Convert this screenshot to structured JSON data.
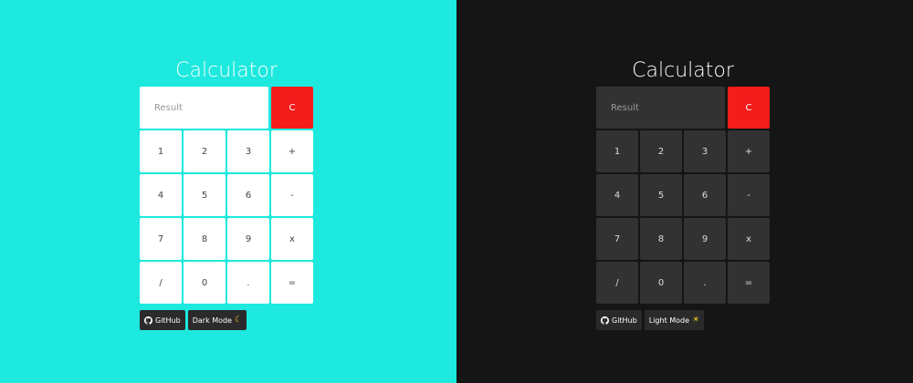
{
  "light": {
    "title": "Calculator",
    "result_placeholder": "Result",
    "clear_label": "C",
    "keys": [
      "1",
      "2",
      "3",
      "+",
      "4",
      "5",
      "6",
      "-",
      "7",
      "8",
      "9",
      "x",
      "/",
      "0",
      ".",
      "="
    ],
    "github_label": "GitHub",
    "mode_label": "Dark Mode",
    "mode_icon": "moon-icon",
    "background": "#1de9de"
  },
  "dark": {
    "title": "Calculator",
    "result_placeholder": "Result",
    "clear_label": "C",
    "keys": [
      "1",
      "2",
      "3",
      "+",
      "4",
      "5",
      "6",
      "-",
      "7",
      "8",
      "9",
      "x",
      "/",
      "0",
      ".",
      "="
    ],
    "github_label": "GitHub",
    "mode_label": "Light Mode",
    "mode_icon": "sun-icon",
    "background": "#151515"
  },
  "colors": {
    "clear_button": "#f51c1c",
    "footer_button": "#2b2b2b"
  }
}
